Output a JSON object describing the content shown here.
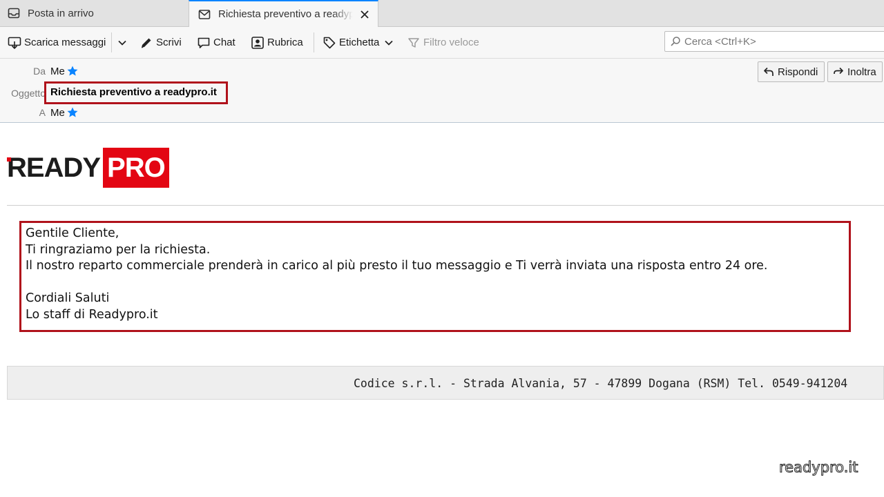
{
  "tabs": [
    {
      "label": "Posta in arrivo",
      "icon": "inbox-icon"
    },
    {
      "label": "Richiesta preventivo a readypro.it",
      "icon": "envelope-icon",
      "active": true
    }
  ],
  "toolbar": {
    "get_messages": "Scarica messaggi",
    "write": "Scrivi",
    "chat": "Chat",
    "address_book": "Rubrica",
    "tag": "Etichetta",
    "quick_filter": "Filtro veloce",
    "search_placeholder": "Cerca <Ctrl+K>"
  },
  "header": {
    "from_label": "Da",
    "from_value": "Me",
    "subject_label": "Oggetto",
    "subject_value": "Richiesta preventivo a readypro.it",
    "to_label": "A",
    "to_value": "Me",
    "reply_label": "Rispondi",
    "forward_label": "Inoltra"
  },
  "message": {
    "logo_left": "READY",
    "logo_right": "PRO",
    "lines": [
      "Gentile Cliente,",
      "Ti ringraziamo per la richiesta.",
      "Il nostro reparto commerciale prenderà in carico al più presto il tuo messaggio e Ti verrà inviata una risposta entro 24 ore.",
      "",
      "Cordiali Saluti",
      "Lo staff di Readypro.it"
    ],
    "footer": "Codice s.r.l. - Strada Alvania, 57 - 47899 Dogana (RSM) Tel. 0549-941204"
  },
  "watermark": "readypro.it",
  "colors": {
    "highlight": "#b0121b",
    "brand_red": "#e30613",
    "star": "#0a84ff",
    "active_tab_accent": "#0a84ff"
  }
}
